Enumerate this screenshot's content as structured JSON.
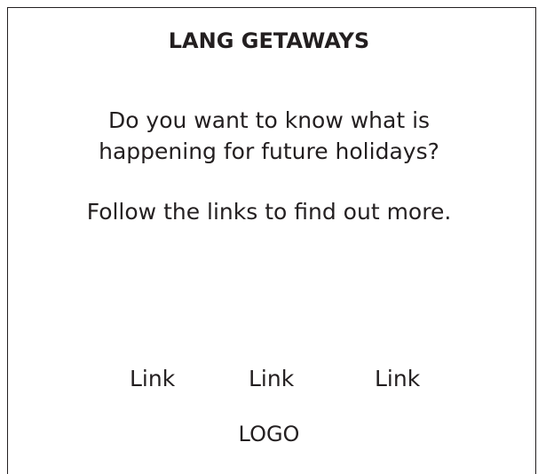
{
  "header": {
    "title": "LANG GETAWAYS"
  },
  "main": {
    "question_line_1": "Do you want to know what is",
    "question_line_2": "happening for future holidays?",
    "instruction": "Follow the links to find out more."
  },
  "links": [
    {
      "label": "Link"
    },
    {
      "label": "Link"
    },
    {
      "label": "Link"
    }
  ],
  "footer": {
    "logo_text": "LOGO"
  },
  "colors": {
    "text": "#231f20",
    "background": "#ffffff",
    "border": "#231f20"
  }
}
